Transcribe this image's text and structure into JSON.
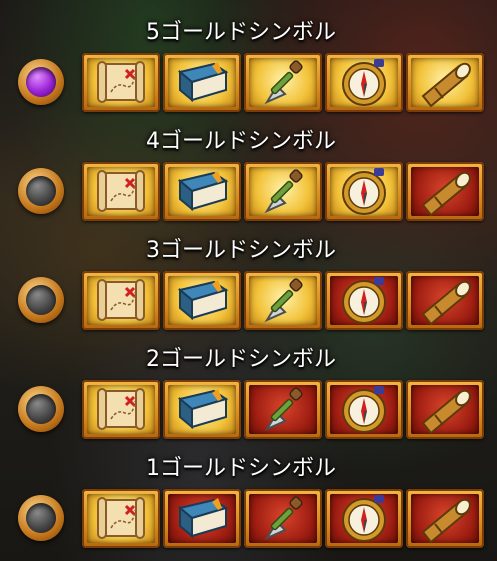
{
  "tiers": [
    {
      "title": "5ゴールドシンボル",
      "active": true,
      "cells": [
        "gold",
        "gold",
        "gold",
        "gold",
        "gold"
      ]
    },
    {
      "title": "4ゴールドシンボル",
      "active": false,
      "cells": [
        "gold",
        "gold",
        "gold",
        "gold",
        "red"
      ]
    },
    {
      "title": "3ゴールドシンボル",
      "active": false,
      "cells": [
        "gold",
        "gold",
        "gold",
        "red",
        "red"
      ]
    },
    {
      "title": "2ゴールドシンボル",
      "active": false,
      "cells": [
        "gold",
        "gold",
        "red",
        "red",
        "red"
      ]
    },
    {
      "title": "1ゴールドシンボル",
      "active": false,
      "cells": [
        "gold",
        "red",
        "red",
        "red",
        "red"
      ]
    }
  ],
  "symbols": [
    "treasure-map-icon",
    "book-icon",
    "shovel-icon",
    "compass-icon",
    "spyglass-icon"
  ],
  "colors": {
    "gold_frame": "#f4b643",
    "gold_fill": "#f2c23a",
    "red_fill": "#9f1e12",
    "active_gem": "#9a23d6",
    "inactive_gem": "#474747"
  }
}
